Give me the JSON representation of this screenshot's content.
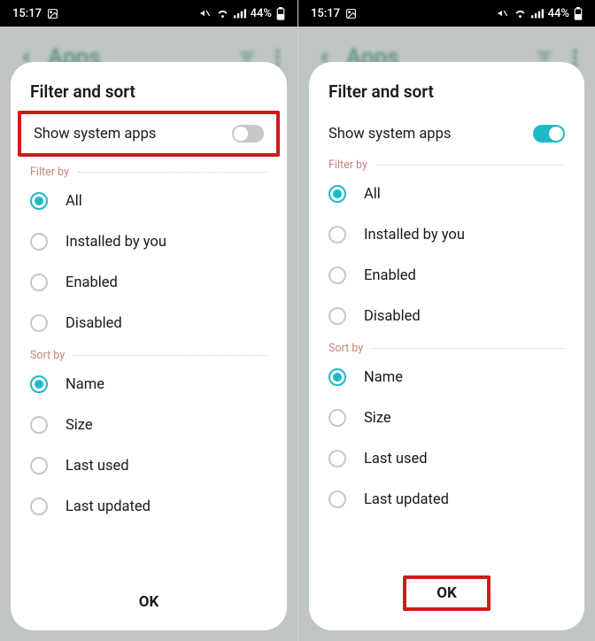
{
  "statusbar": {
    "time": "15:17",
    "battery": "44%"
  },
  "bg": {
    "title": "Apps"
  },
  "dialog": {
    "title": "Filter and sort",
    "show_system": "Show system apps",
    "filter_by": "Filter by",
    "sort_by": "Sort by",
    "ok": "OK"
  },
  "filter": {
    "all": "All",
    "installed": "Installed by you",
    "enabled": "Enabled",
    "disabled": "Disabled"
  },
  "sort": {
    "name": "Name",
    "size": "Size",
    "last_used": "Last used",
    "last_updated": "Last updated"
  },
  "left": {
    "toggle_on": false,
    "highlight": "toggle"
  },
  "right": {
    "toggle_on": true,
    "highlight": "ok"
  }
}
